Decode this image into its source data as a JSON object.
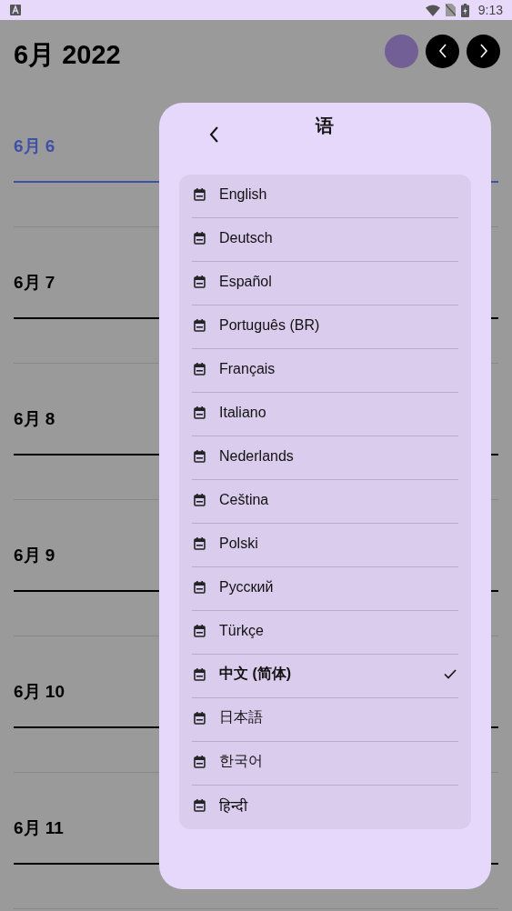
{
  "status_bar": {
    "time": "9:13"
  },
  "header": {
    "title": "6月 2022"
  },
  "days": [
    {
      "label": "6月 6",
      "selected": true
    },
    {
      "label": "6月 7",
      "selected": false
    },
    {
      "label": "6月 8",
      "selected": false
    },
    {
      "label": "6月 9",
      "selected": false
    },
    {
      "label": "6月 10",
      "selected": false
    },
    {
      "label": "6月 11",
      "selected": false
    }
  ],
  "dialog": {
    "title": "语",
    "languages": [
      {
        "label": "English",
        "selected": false
      },
      {
        "label": "Deutsch",
        "selected": false
      },
      {
        "label": "Español",
        "selected": false
      },
      {
        "label": "Português (BR)",
        "selected": false
      },
      {
        "label": "Français",
        "selected": false
      },
      {
        "label": "Italiano",
        "selected": false
      },
      {
        "label": "Nederlands",
        "selected": false
      },
      {
        "label": "Ceština",
        "selected": false
      },
      {
        "label": "Polski",
        "selected": false
      },
      {
        "label": "Русский",
        "selected": false
      },
      {
        "label": "Türkçe",
        "selected": false
      },
      {
        "label": "中文 (简体)",
        "selected": true
      },
      {
        "label": "日本語",
        "selected": false
      },
      {
        "label": "한국어",
        "selected": false
      },
      {
        "label": "हिन्दी",
        "selected": false
      }
    ]
  }
}
